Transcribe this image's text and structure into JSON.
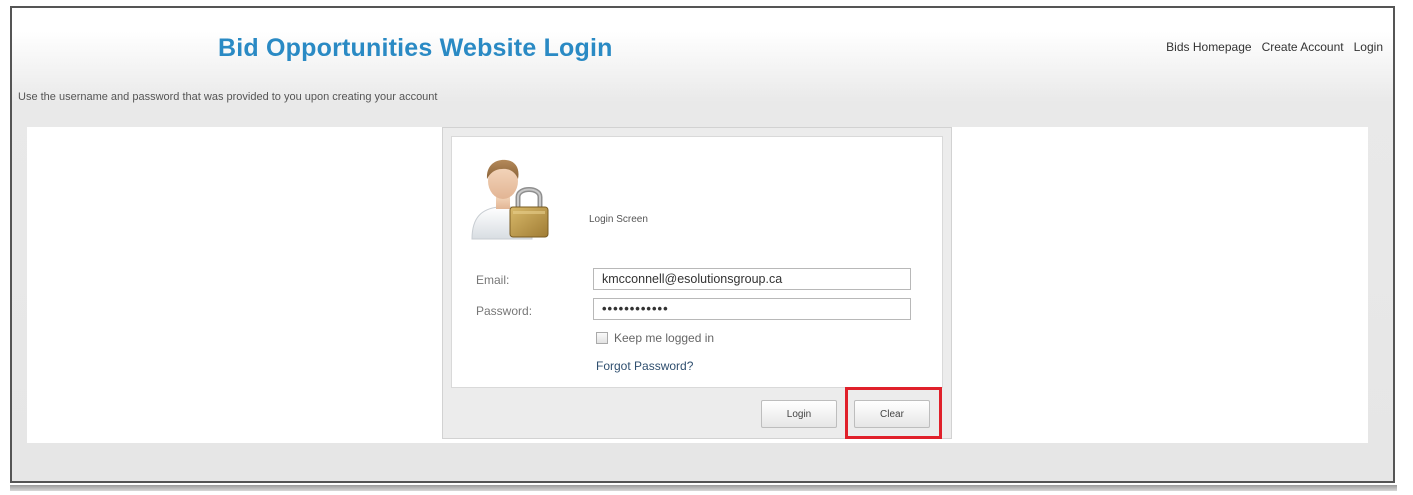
{
  "header": {
    "title": "Bid Opportunities Website Login",
    "links": [
      "Bids Homepage",
      "Create Account",
      "Login"
    ]
  },
  "instructions": "Use the username and password that was provided to you upon creating your account",
  "login_panel": {
    "screen_label": "Login Screen",
    "email_label": "Email:",
    "email_value": "kmcconnell@esolutionsgroup.ca",
    "password_label": "Password:",
    "password_value": "••••••••••••",
    "keep_logged_in": "Keep me logged in",
    "forgot_password": "Forgot Password?",
    "login_button": "Login",
    "clear_button": "Clear"
  },
  "colors": {
    "title": "#2a8ac4",
    "highlight": "#e0202a"
  },
  "icons": {
    "user_lock": "user-lock-icon"
  }
}
